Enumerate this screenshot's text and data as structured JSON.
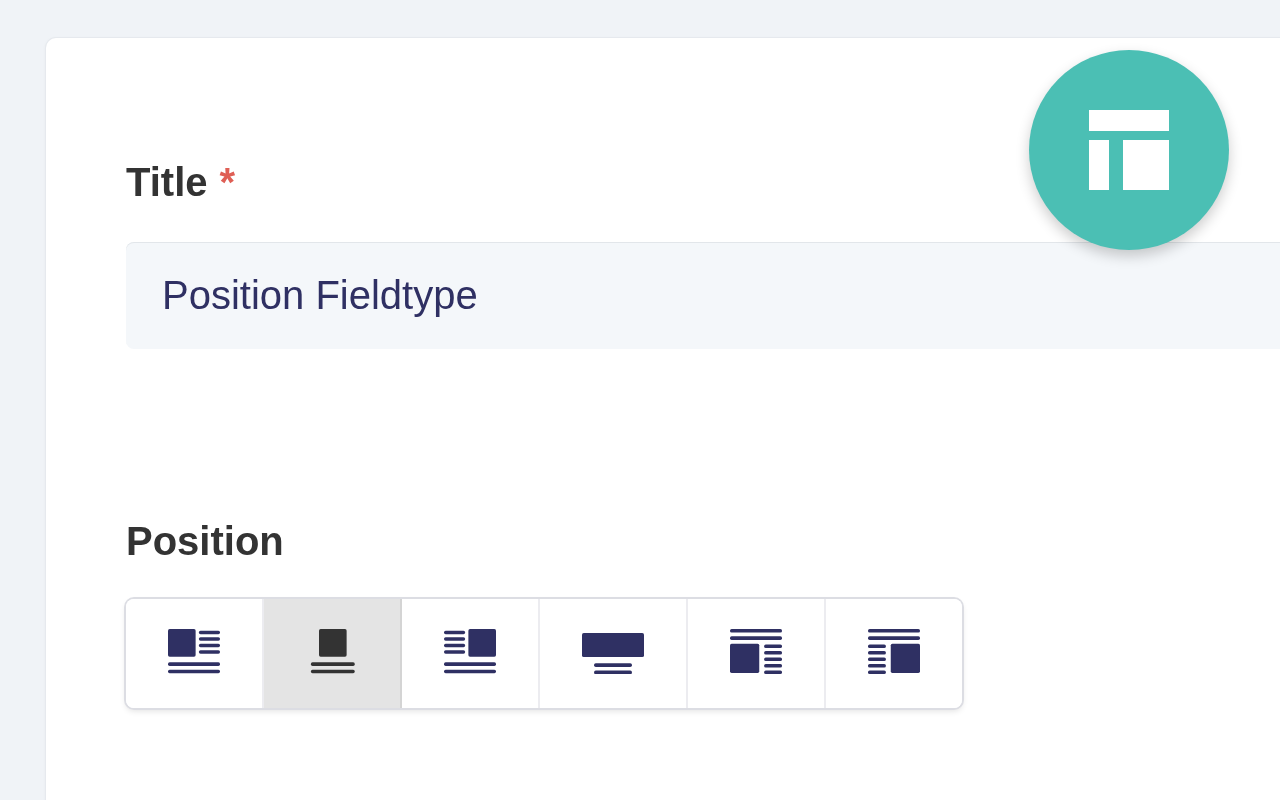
{
  "title_field": {
    "label": "Title",
    "required_mark": "*",
    "value": "Position Fieldtype"
  },
  "position_field": {
    "label": "Position",
    "options": [
      {
        "kind": "image-left",
        "selected": false
      },
      {
        "kind": "image-center",
        "selected": true
      },
      {
        "kind": "image-right",
        "selected": false
      },
      {
        "kind": "image-top-wide",
        "selected": false
      },
      {
        "kind": "text-top-image-left",
        "selected": false
      },
      {
        "kind": "text-top-image-right",
        "selected": false
      }
    ]
  }
}
